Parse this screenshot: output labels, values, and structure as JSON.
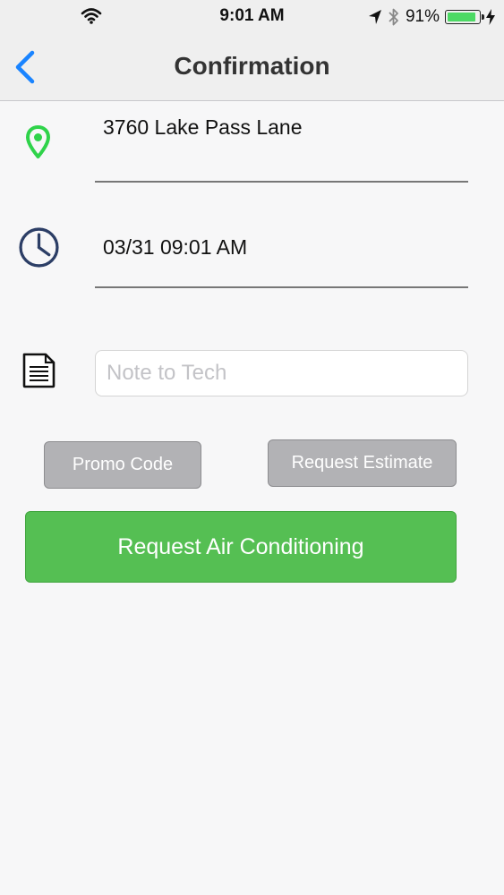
{
  "status_bar": {
    "time": "9:01 AM",
    "battery_percent": "91%",
    "battery_level": 0.91
  },
  "nav": {
    "title": "Confirmation",
    "back_icon": "chevron-left-icon"
  },
  "form": {
    "address": "3760 Lake Pass Lane",
    "datetime": "03/31 09:01 AM",
    "note_placeholder": "Note to Tech",
    "note_value": ""
  },
  "buttons": {
    "promo_code": "Promo Code",
    "request_estimate": "Request Estimate",
    "request_service": "Request Air Conditioning"
  },
  "icons": {
    "location": "map-pin-icon",
    "time": "clock-icon",
    "note": "document-icon"
  },
  "colors": {
    "accent_blue": "#1a84ff",
    "pin_green": "#2fd34a",
    "clock_navy": "#2c3e66",
    "primary_green": "#55bf53",
    "secondary_gray": "#b2b2b5"
  }
}
